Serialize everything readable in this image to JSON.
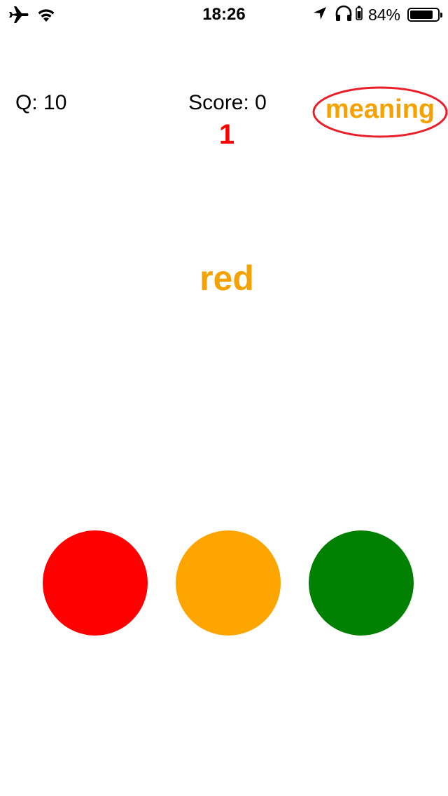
{
  "status_bar": {
    "time": "18:26",
    "battery_percent": "84%",
    "battery_level": 0.84,
    "icons": [
      "airplane-icon",
      "wifi-icon",
      "location-arrow-icon",
      "headphones-icon",
      "battery-icon"
    ]
  },
  "game": {
    "question_label": "Q: 10",
    "score_label": "Score: 0",
    "counter": "1",
    "mode_label": "meaning",
    "prompt_word": "red"
  },
  "colors": {
    "counter": "#ff0000",
    "mode_text": "#f5a100",
    "mode_ring": "#e8202a",
    "prompt_word": "#f5a100"
  },
  "answer_buttons": [
    {
      "name": "red",
      "color": "#ff0000"
    },
    {
      "name": "orange",
      "color": "#ffa500"
    },
    {
      "name": "green",
      "color": "#008000"
    }
  ]
}
